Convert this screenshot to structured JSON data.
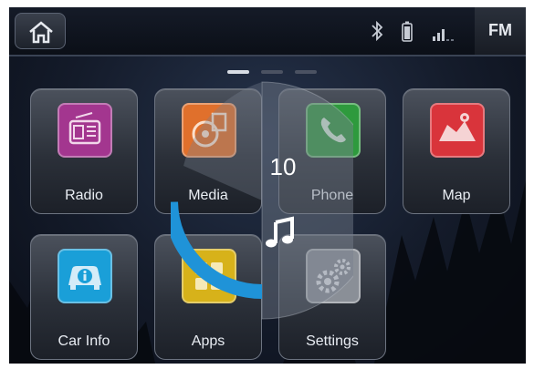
{
  "status_bar": {
    "home_icon": "home-icon",
    "icons": [
      "bluetooth-icon",
      "battery-icon",
      "signal-icon"
    ],
    "source_label": "FM"
  },
  "pager": {
    "page_count": 3,
    "active_page": 1
  },
  "apps": [
    {
      "label": "Radio",
      "icon": "radio-icon",
      "color": "#a3368f"
    },
    {
      "label": "Media",
      "icon": "media-icon",
      "color": "#e0702c"
    },
    {
      "label": "Phone",
      "icon": "phone-icon",
      "color": "#2e9a3d"
    },
    {
      "label": "Map",
      "icon": "map-icon",
      "color": "#d9343b"
    },
    {
      "label": "Car Info",
      "icon": "car-info-icon",
      "color": "#1a9fd8"
    },
    {
      "label": "Apps",
      "icon": "apps-icon",
      "color": "#d7b21a"
    },
    {
      "label": "Settings",
      "icon": "settings-icon",
      "color": "#8a8f97"
    }
  ],
  "volume_overlay": {
    "value": "10",
    "level": 0.33,
    "icon": "music-note-icon",
    "accent": "#1f93d8"
  }
}
